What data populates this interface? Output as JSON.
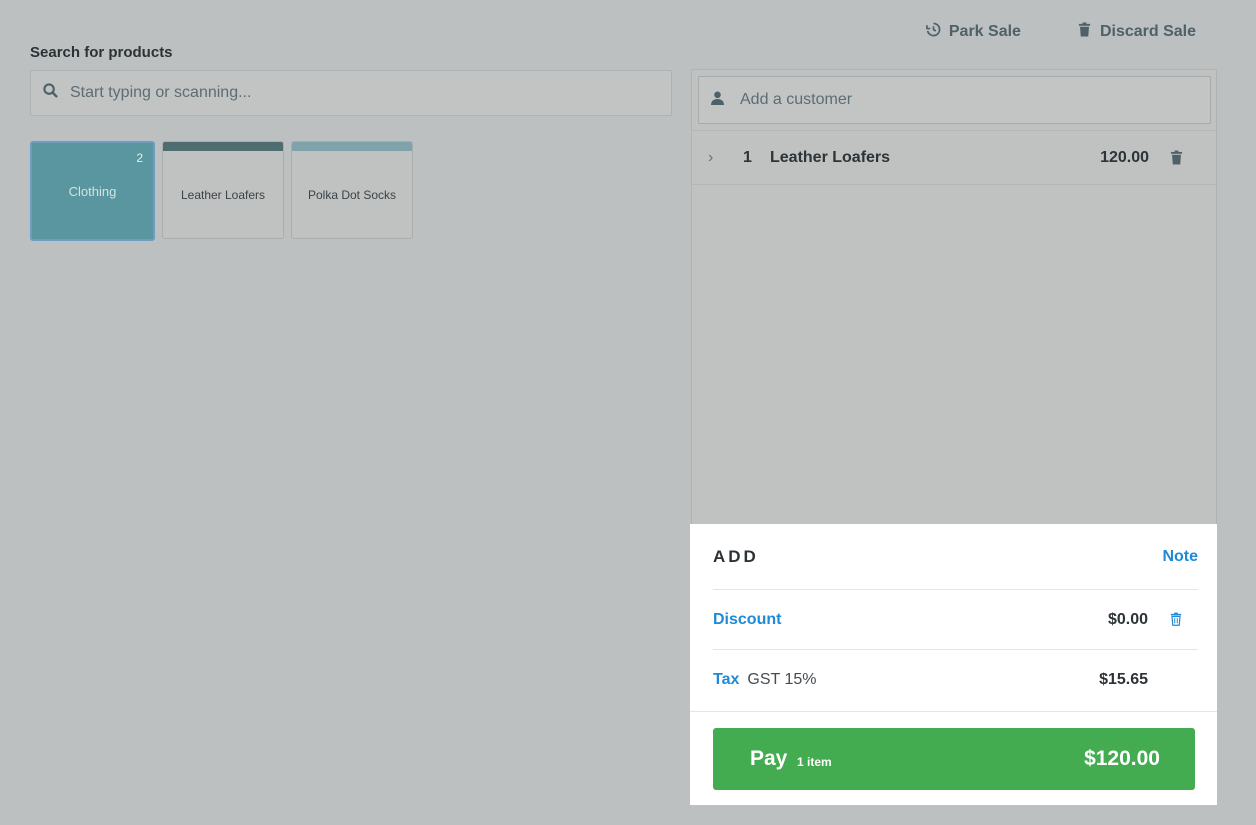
{
  "top_actions": {
    "park_sale": "Park Sale",
    "discard_sale": "Discard Sale"
  },
  "search": {
    "label": "Search for products",
    "placeholder": "Start typing or scanning..."
  },
  "tiles": [
    {
      "label": "Clothing",
      "count": "2",
      "type": "category",
      "color": "#5a969f"
    },
    {
      "label": "Leather Loafers",
      "type": "product",
      "bar_color": "#4f6d6e"
    },
    {
      "label": "Polka Dot Socks",
      "type": "product",
      "bar_color": "#7fa3aa"
    }
  ],
  "customer": {
    "placeholder": "Add a customer"
  },
  "line_items": [
    {
      "qty": "1",
      "name": "Leather Loafers",
      "price": "120.00"
    }
  ],
  "summary": {
    "add_title": "ADD",
    "note_link": "Note",
    "discount_label": "Discount",
    "discount_amount": "$0.00",
    "tax_label": "Tax",
    "tax_desc": "GST 15%",
    "tax_amount": "$15.65"
  },
  "pay": {
    "label": "Pay",
    "items": "1 item",
    "amount": "$120.00",
    "color": "#43ac51"
  },
  "colors": {
    "accent_link": "#1f8ad6",
    "overlay_gray": "#bdc0c0"
  }
}
